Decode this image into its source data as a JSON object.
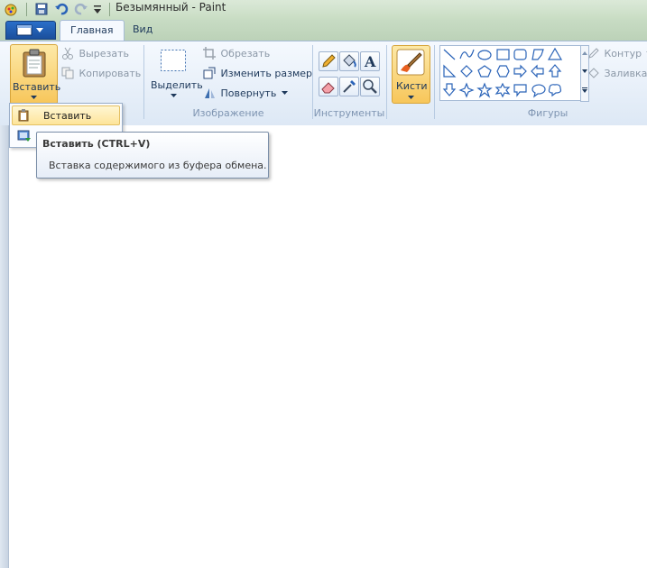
{
  "window": {
    "title": "Безымянный - Paint"
  },
  "tabs": [
    {
      "label": "Главная"
    },
    {
      "label": "Вид"
    }
  ],
  "clipboard": {
    "paste_label": "Вставить",
    "cut_label": "Вырезать",
    "copy_label": "Копировать"
  },
  "image": {
    "group_label": "Изображение",
    "select_label": "Выделить",
    "crop_label": "Обрезать",
    "resize_label": "Изменить размер",
    "rotate_label": "Повернуть"
  },
  "tools": {
    "group_label": "Инструменты"
  },
  "brushes": {
    "label": "Кисти"
  },
  "shapes": {
    "group_label": "Фигуры",
    "outline_label": "Контур",
    "fill_label": "Заливка"
  },
  "paste_menu": {
    "items": [
      {
        "label": "Вставить"
      }
    ]
  },
  "tooltip": {
    "title": "Вставить (CTRL+V)",
    "description": "Вставка содержимого из буфера обмена."
  },
  "colors": {
    "accent": "#f7c65a",
    "ribbon_bg": "#dde8f5",
    "file_tab": "#1b4f9c"
  }
}
